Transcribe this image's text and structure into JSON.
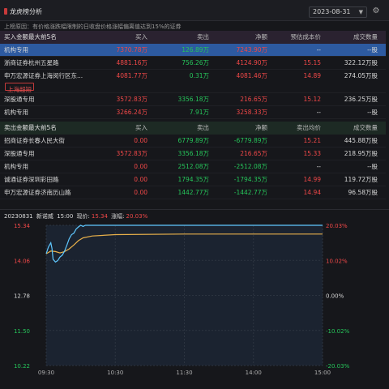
{
  "app": {
    "title": "龙虎榜分析",
    "date": "2023-08-31"
  },
  "reason": "上榜原因：有价格涨跌幅限制的日收盘价格涨幅偏离值达到15%的证券",
  "buy_section": {
    "header": [
      "买入金额最大前5名",
      "买入",
      "卖出",
      "净额",
      "预估成本价",
      "成交数量"
    ],
    "rows": [
      {
        "name": "机构专用",
        "buy": "7370.78万",
        "sell": "126.89万",
        "net": "7243.90万",
        "cost": "--",
        "volume": "--股",
        "selected": true
      },
      {
        "name": "浙商证券杭州五星路",
        "buy": "4881.16万",
        "sell": "756.26万",
        "net": "4124.90万",
        "cost": "15.15",
        "volume": "322.12万股"
      },
      {
        "name": "申万宏源证券上海闵行区东...",
        "buy": "4081.77万",
        "sell": "0.31万",
        "net": "4081.46万",
        "cost": "14.89",
        "volume": "274.05万股",
        "tag": "上海超短"
      },
      {
        "name": "深股通专用",
        "buy": "3572.83万",
        "sell": "3356.18万",
        "net": "216.65万",
        "cost": "15.12",
        "volume": "236.25万股"
      },
      {
        "name": "机构专用",
        "buy": "3266.24万",
        "sell": "7.91万",
        "net": "3258.33万",
        "cost": "--",
        "volume": "--股"
      }
    ]
  },
  "sell_section": {
    "header": [
      "卖出金额最大前5名",
      "买入",
      "卖出",
      "净额",
      "卖出均价",
      "成交数量"
    ],
    "rows": [
      {
        "name": "招商证券长春人民大街",
        "buy": "0.00",
        "sell": "6779.89万",
        "net": "-6779.89万",
        "cost": "15.21",
        "volume": "445.88万股"
      },
      {
        "name": "深股通专用",
        "buy": "3572.83万",
        "sell": "3356.18万",
        "net": "216.65万",
        "cost": "15.33",
        "volume": "218.95万股"
      },
      {
        "name": "机构专用",
        "buy": "0.00",
        "sell": "2512.08万",
        "net": "-2512.08万",
        "cost": "--",
        "volume": "--股"
      },
      {
        "name": "诚通证券深圳彩田路",
        "buy": "0.00",
        "sell": "1794.35万",
        "net": "-1794.35万",
        "cost": "14.99",
        "volume": "119.72万股"
      },
      {
        "name": "申万宏源证券济南历山路",
        "buy": "0.00",
        "sell": "1442.77万",
        "net": "-1442.77万",
        "cost": "14.94",
        "volume": "96.58万股"
      }
    ]
  },
  "chart_info": {
    "date": "20230831",
    "name": "新诺威",
    "time": "15:00",
    "price_label": "现价:",
    "price": "15.34",
    "change_label": "涨幅:",
    "change": "20.03%"
  },
  "colors": {
    "up": "#f04848",
    "down": "#26c55a",
    "price_line": "#5fc8ff",
    "avg_line": "#e8b04a",
    "selected_row": "#2d5aa0"
  },
  "chart_data": {
    "type": "line",
    "title": "",
    "x_ticks": [
      "09:30",
      "10:30",
      "11:30",
      "14:00",
      "15:00"
    ],
    "y_ticks_left": [
      "15.34",
      "14.06",
      "12.78",
      "11.50",
      "10.22"
    ],
    "y_ticks_right": [
      "20.03%",
      "10.02%",
      "0.00%",
      "-10.02%",
      "-20.03%"
    ],
    "ylim": [
      10.22,
      15.34
    ],
    "prev_close": 12.78,
    "series": [
      {
        "x_minutes": [
          0,
          2,
          4,
          5,
          6,
          8,
          10,
          12,
          14,
          16,
          18,
          20,
          22,
          24,
          26,
          28,
          30,
          32,
          34,
          36,
          40,
          60,
          120,
          180,
          240
        ],
        "values": [
          14.3,
          14.55,
          14.7,
          14.5,
          14.1,
          14.0,
          14.05,
          14.18,
          14.25,
          14.4,
          14.62,
          14.85,
          15.0,
          15.05,
          15.2,
          15.28,
          15.34,
          15.3,
          15.34,
          15.34,
          15.34,
          15.34,
          15.34,
          15.34,
          15.34
        ]
      },
      {
        "x_minutes": [
          0,
          4,
          8,
          12,
          16,
          20,
          24,
          28,
          32,
          40,
          60,
          120,
          180,
          240
        ],
        "values": [
          14.3,
          14.4,
          14.38,
          14.33,
          14.38,
          14.48,
          14.62,
          14.78,
          14.88,
          14.95,
          15.0,
          15.02,
          15.02,
          15.02
        ]
      }
    ]
  }
}
